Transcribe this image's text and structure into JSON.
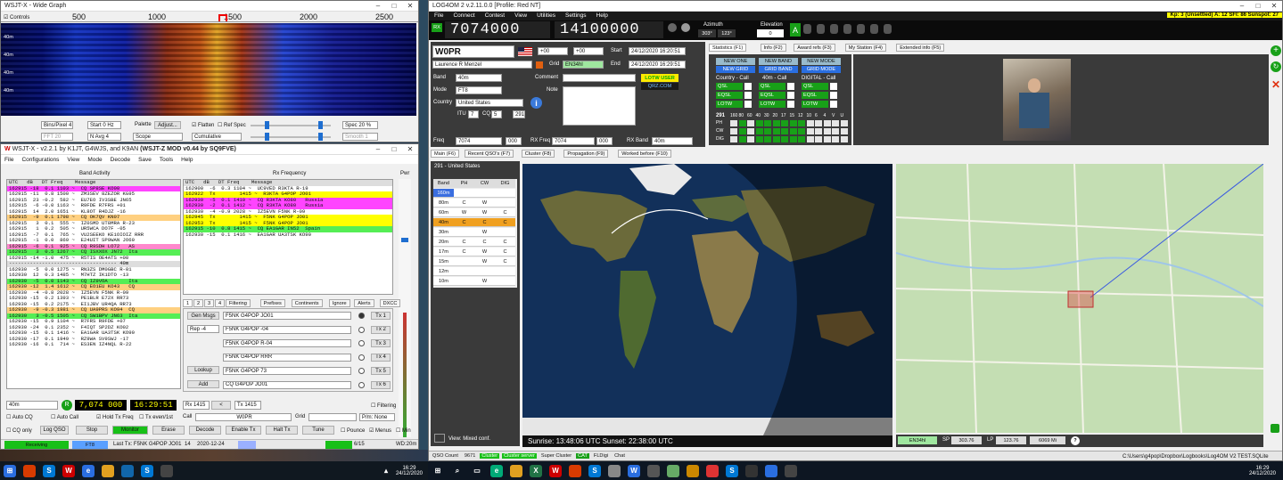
{
  "wide_graph": {
    "title": "WSJT-X - Wide Graph",
    "controls_label": "Controls",
    "scale": [
      "500",
      "1000",
      "1500",
      "2000",
      "2500"
    ],
    "bins_label": "Bins/Pixel",
    "bins_value": "4",
    "start_label": "Start",
    "start_value": "0 Hz",
    "palette_label": "Palette",
    "adjust_label": "Adjust...",
    "flatten_label": "Flatten",
    "ref_spec_label": "Ref Spec",
    "spec_label": "Spec",
    "spec_value": "20 %",
    "fft_label": "FFT 20",
    "nav_label": "N Avg",
    "nav_value": "4",
    "scope_label": "Scope",
    "cumulative_label": "Cumulative",
    "smooth_label": "Smooth",
    "smooth_value": "1",
    "band_marks": [
      "40m",
      "40m",
      "40m",
      "40m"
    ]
  },
  "wsjt": {
    "title": "WSJT-X - v2.2.1 by K1JT, G4WJS, and K9AN",
    "title_bold": "(WSJT-Z MOD v0.44 by SQ9FVE)",
    "menu": [
      "File",
      "Configurations",
      "View",
      "Mode",
      "Decode",
      "Save",
      "Tools",
      "Help"
    ],
    "band_activity": "Band Activity",
    "rx_frequency": "Rx Frequency",
    "pwr": "Pwr",
    "header": "UTC   dB   DT Freq    Message",
    "band_rows": [
      {
        "t": "162915 -18  0.1 1103 ~  CQ SP8SE KO00",
        "c": "#ff44ff"
      },
      {
        "t": "162915 -11  0.8 1500 ~  ZM3SEV 8ZEZOR KG95",
        "c": "#fff"
      },
      {
        "t": "162915  23 -0.2  582 ~  EU7EO IV3SBE JN65",
        "c": "#fff"
      },
      {
        "t": "162915  -6 -0.0 1163 ~  R9FDE R7FRS +01",
        "c": "#fff"
      },
      {
        "t": "162915  14  2.0 1651 ~  KL8OT R4DJZ -16",
        "c": "#fff"
      },
      {
        "t": "162915  -9  0.1 1798 ~  CQ OK7QV KN07",
        "c": "#ffd080"
      },
      {
        "t": "162915   3  0.1  555 ~  IZ0SMD UT8MRA R-23",
        "c": "#fff"
      },
      {
        "t": "162915   1  0.2  505 ~  UR5WCA DO7F -05",
        "c": "#fff"
      },
      {
        "t": "162915  -7  0.1  765 ~  VU2SEEKO KE1OIOIZ RRR",
        "c": "#fff"
      },
      {
        "t": "162915  -1  0.0  869 ~  E24UIT SP9WAN JO60",
        "c": "#fff"
      },
      {
        "t": "162915  -6  0.1  925 ~  CQ R9SDH LO72   AS",
        "c": "#ff88cc"
      },
      {
        "t": "162915   3  0.5 1267 ~  CQ ISXXOX JN72  Ita",
        "c": "#55ee55"
      },
      {
        "t": "162915 -14 -1.0  475 ~  R5TIS OE4ATS +00",
        "c": "#fff"
      },
      {
        "t": "------------------------------------ 40m",
        "c": "#ddd"
      },
      {
        "t": "162930  -5  0.0 1275 ~  RN3ZS DM0GBC R-01",
        "c": "#fff"
      },
      {
        "t": "162930  12  0.3 1485 ~  M7HTZ IK1DTO -13",
        "c": "#fff"
      },
      {
        "t": "162930  -5  0.0 1143 ~  CQ IZ9VOA       Ita",
        "c": "#55ee55"
      },
      {
        "t": "162930 -12  1.4 1612 ~  CQ EO1EU KO43   CQ",
        "c": "#ffd080"
      },
      {
        "t": "162930  -4 -0.8 2028 ~  IZ5EVN F5NK R-09",
        "c": "#fff"
      },
      {
        "t": "162930 -15  0.2 1393 ~  PE1BLR E72X RR73",
        "c": "#fff"
      },
      {
        "t": "162930 -15  0.2 2175 ~  EI1JBV UR4QA RR73",
        "c": "#fff"
      },
      {
        "t": "162930  -9 -0.3 1981 ~  CQ UA9PRS KO94  CQ",
        "c": "#ffd080"
      },
      {
        "t": "162930   3 -0.5 1505 ~  CQ SW1BPV JN63  Ita",
        "c": "#55ee55"
      },
      {
        "t": "162930 -15  0.9 1104 ~  R7FRS R9FDE +07",
        "c": "#fff"
      },
      {
        "t": "162930 -24  0.1 2352 ~  F4IQT SP2DZ KO02",
        "c": "#fff"
      },
      {
        "t": "162930 -15  0.1 1416 ~  EA1GAR UA3TSK KO90",
        "c": "#fff"
      },
      {
        "t": "162930 -17  0.1 1949 ~  RZ9WA SV9SWJ -17",
        "c": "#fff"
      },
      {
        "t": "162930 -16  0.1  714 ~  ES3EN IZ4NQL R-22",
        "c": "#fff"
      }
    ],
    "rx_rows": [
      {
        "t": "162900  -6  0.3 1104 ~  UC9VED R3KTA R-19",
        "c": "#fff"
      },
      {
        "t": "162922  Tx        1415 ~  R3KTA G4POP JO01",
        "c": "#ffff00"
      },
      {
        "t": "162930  -5  0.1 1410 ~  CQ R3KTA KO80   Russia",
        "c": "#ff44ff"
      },
      {
        "t": "162930  -2  0.1 1412 ~  CQ R3KTA KO80   Russia",
        "c": "#ff44ff"
      },
      {
        "t": "162930  -4 -0.9 2028 ~  IZ5EVN F5NK R-09",
        "c": "#fff"
      },
      {
        "t": "162945  Tx        1415 ~  F5NK G4POP JO01",
        "c": "#ffff00"
      },
      {
        "t": "162953  Tx        1415 ~  F5NK G4POP JO01",
        "c": "#ffff00"
      },
      {
        "t": "162915 -10  0.8 1415 ~  CQ EA1GAR IN52  Spain",
        "c": "#55ee55"
      },
      {
        "t": "162930 -15  0.1 1416 ~  EA1GAR UA3TSK KO90",
        "c": "#fff"
      }
    ],
    "tabs": [
      "1",
      "2",
      "3",
      "4",
      "Filtering",
      "Prefixes",
      "Continents",
      "Ignore",
      "Alerts",
      "DXCC"
    ],
    "gen_msgs": "Gen Msgs",
    "rep_label": "Rep -4",
    "lookup": "Lookup",
    "add": "Add",
    "tx_msgs": [
      "F5NK G4POP JO01",
      "F5NK G4POP -04",
      "F5NK G4POP R-04",
      "F5NK G4POP RRR",
      "F5NK G4POP 73",
      "CQ G4POP JO01"
    ],
    "tx_btns": [
      "Tx 1",
      "Tx 2",
      "Tx 3",
      "Tx 4",
      "Tx 5",
      "Tx 6"
    ],
    "band": "40m",
    "freq": "7,074 000",
    "time": "16:29:51",
    "rx_label": "Rx 1415",
    "tx_label": "Tx 1415",
    "filtering": "Filtering",
    "auto_cq": "Auto CQ",
    "auto_call": "Auto Call",
    "hold_tx": "Hold Tx Freq",
    "tx_even": "Tx even/1st",
    "call_label": "Call",
    "call_value": "W0PR",
    "grid_label": "Grid",
    "pm": "P/m: None",
    "cq_only": "CQ only",
    "log_qso": "Log QSO",
    "stop": "Stop",
    "monitor": "Monitor",
    "erase": "Erase",
    "decode": "Decode",
    "enable_tx": "Enable Tx",
    "halt_tx": "Halt Tx",
    "tune": "Tune",
    "pounce": "Pounce",
    "menus": "Menus",
    "min": "Min",
    "status_rx": "Receiving",
    "status_mode": "FT8",
    "last_tx": "Last Tx: F5NK G4POP JO01",
    "s14": "14",
    "date": "2020-12-24",
    "s15": "6/15",
    "wd": "WD:20m"
  },
  "log": {
    "title": "LOG4OM 2 v.2.11.0.0 [Profile: Red NT]",
    "kp": "Kp: 3 (Unsettled) A: 12 SFI: 86 Sunspot: 27",
    "menu": [
      "File",
      "Connect",
      "Contest",
      "View",
      "Utilities",
      "Settings",
      "Help"
    ],
    "freq_tx": "7074000",
    "freq_rx": "14100000",
    "azimuth_label": "Azimuth",
    "elevation_label": "Elevation",
    "az1": "303°",
    "az2": "123°",
    "el": "0",
    "rx": "RX",
    "call": "W0PR",
    "name": "Laurence R Menzel",
    "start_label": "Start",
    "start": "24/12/2020 16:20:51",
    "end_label": "End",
    "end": "24/12/2020 16:29:51",
    "grid_label": "Grid",
    "grid": "EN34hl",
    "band_label": "Band",
    "band": "40m",
    "mode_label": "Mode",
    "mode": "FT8",
    "comment_label": "Comment",
    "note_label": "Note",
    "country_label": "Country",
    "country": "United States",
    "itu": "ITU",
    "itu_v": "7",
    "cq": "CQ",
    "cq_v": "5",
    "dxcc_n": "291",
    "freq_label": "Freq",
    "freq": "7074",
    "khz": "000",
    "rxfreq_label": "RX Freq",
    "rxfreq": "7074",
    "rxband_label": "RX Band",
    "rxband": "40m",
    "lotw_label": "LOTW USER",
    "qrz": "QRZ.COM",
    "rst_s": "+00",
    "rst_r": "+00",
    "stat_tabs": [
      "Statistics (F1)",
      "Info (F2)",
      "Award refs (F3)",
      "My Station (F4)",
      "Extended info (F5)"
    ],
    "new_one": "NEW ONE",
    "new_band": "NEW BAND",
    "new_mode": "NEW MODE",
    "new_grid": "NEW GRID",
    "grid_band": "GRID BAND",
    "grid_mode": "GRID MODE",
    "country_call": "Country - Call",
    "band_call": "40m - Call",
    "digital_call": "DIGITAL - Call",
    "qsl": "QSL",
    "eqsl": "EQSL",
    "lotw": "LOTW",
    "dx_count": "291",
    "bands_row": [
      "160",
      "80",
      "60",
      "40",
      "30",
      "20",
      "17",
      "15",
      "12",
      "10",
      "6",
      "4",
      "V",
      "U"
    ],
    "modes_row": [
      "PH",
      "CW",
      "DIG"
    ],
    "lower_tabs": [
      "Main (F6)",
      "Recent QSO's (F7)",
      "Cluster (F8)",
      "Propagation (F9)",
      "Worked before (F10)"
    ],
    "wb_title": "291 - United States",
    "wb_head": [
      "Band",
      "PH",
      "CW",
      "DIG"
    ],
    "wb_rows": [
      [
        "160m",
        "",
        "",
        ""
      ],
      [
        "80m",
        "C",
        "W",
        ""
      ],
      [
        "60m",
        "W",
        "W",
        "C"
      ],
      [
        "40m",
        "C",
        "C",
        "C"
      ],
      [
        "30m",
        "",
        "W",
        ""
      ],
      [
        "20m",
        "C",
        "C",
        "C"
      ],
      [
        "17m",
        "C",
        "W",
        "C"
      ],
      [
        "15m",
        "",
        "W",
        "C"
      ],
      [
        "12m",
        "",
        "",
        ""
      ],
      [
        "10m",
        "",
        "W",
        ""
      ]
    ],
    "view_label": "View: Mixed conf.",
    "sun": "Sunrise: 13:48:06 UTC  Sunset: 22:38:00 UTC",
    "grid_small": "EN34hl",
    "sp_label": "SP",
    "sp": "303.76",
    "lp_label": "LP",
    "lp": "123.76",
    "dist": "6069 Mi",
    "status": [
      "QSO Count",
      "9671",
      "Cluster",
      "Cluster server",
      "Super Cluster",
      "CAT",
      "FLDigi",
      "Chat"
    ],
    "db_path": "C:\\Users\\g4pop\\Dropbox\\Logbooks\\Log4OM V2 TEST.SQLite"
  },
  "taskbar": {
    "time": "16:29",
    "date": "24/12/2020",
    "time2": "16:29",
    "date2": "24/12/2020"
  },
  "colors": {
    "green": "#18a018",
    "magenta": "#ff44ff",
    "yellow": "#ffff00",
    "lgreen": "#55ee55",
    "blue": "#3366cc",
    "navy": "#1a3a8a"
  }
}
